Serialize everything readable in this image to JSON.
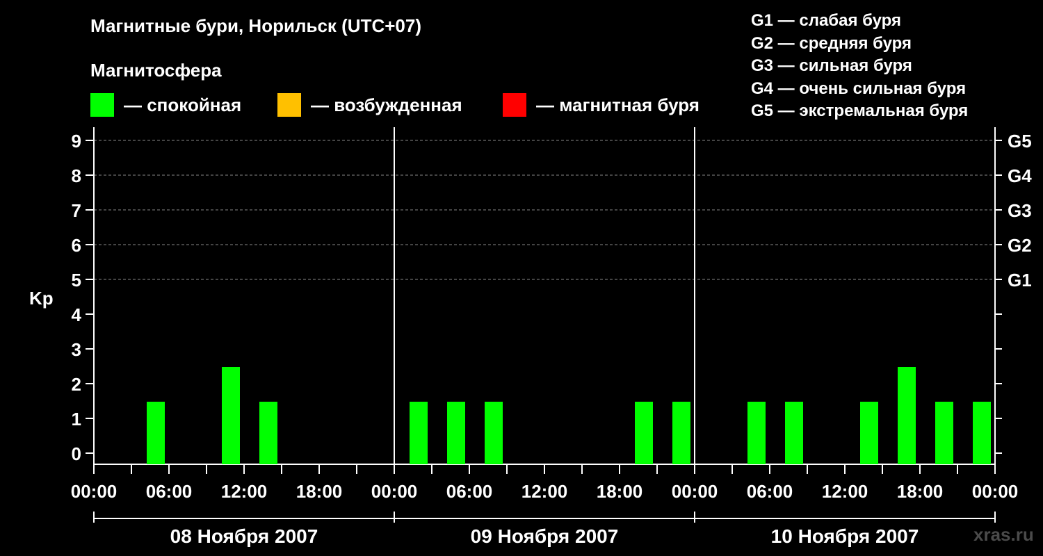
{
  "title": "Магнитные бури, Норильск (UTC+07)",
  "magnetosphere_title": "Магнитосфера",
  "legend": [
    {
      "label": "— спокойная",
      "color": "#00ff00"
    },
    {
      "label": "— возбужденная",
      "color": "#ffc000"
    },
    {
      "label": "— магнитная буря",
      "color": "#ff0000"
    }
  ],
  "g_legend": [
    "G1 — слабая буря",
    "G2 — средняя буря",
    "G3 — сильная буря",
    "G4 — очень сильная буря",
    "G5 — экстремальная буря"
  ],
  "watermark": "xras.ru",
  "chart_data": {
    "type": "bar",
    "ylabel": "Kp",
    "ylim": [
      0,
      9
    ],
    "y_ticks": [
      "0",
      "1",
      "2",
      "3",
      "4",
      "5",
      "6",
      "7",
      "8",
      "9"
    ],
    "right_axis_labels": [
      {
        "kp": 5,
        "label": "G1"
      },
      {
        "kp": 6,
        "label": "G2"
      },
      {
        "kp": 7,
        "label": "G3"
      },
      {
        "kp": 8,
        "label": "G4"
      },
      {
        "kp": 9,
        "label": "G5"
      }
    ],
    "x_tick_labels": [
      "00:00",
      "06:00",
      "12:00",
      "18:00",
      "00:00",
      "06:00",
      "12:00",
      "18:00",
      "00:00",
      "06:00",
      "12:00",
      "18:00",
      "00:00"
    ],
    "days": [
      "08 Ноября 2007",
      "09 Ноября 2007",
      "10 Ноября 2007"
    ],
    "interval_hours": 3,
    "series": [
      {
        "day": "08 Ноября 2007",
        "values": [
          0,
          1,
          0,
          2,
          1,
          0,
          0,
          0
        ]
      },
      {
        "day": "09 Ноября 2007",
        "values": [
          1,
          1,
          1,
          0,
          0,
          0,
          1,
          1
        ]
      },
      {
        "day": "10 Ноября 2007",
        "values": [
          0,
          1,
          1,
          0,
          1,
          2,
          1,
          1
        ]
      }
    ],
    "colors": {
      "quiet": "#00ff00",
      "active": "#ffc000",
      "storm": "#ff0000"
    },
    "grid": true
  }
}
